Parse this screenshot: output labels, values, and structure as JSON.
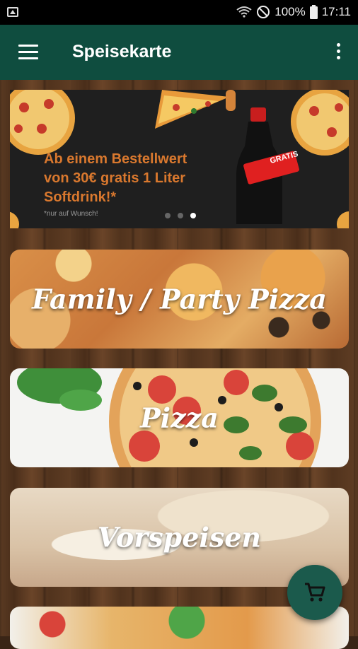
{
  "status_bar": {
    "battery": "100%",
    "time": "17:11"
  },
  "app_bar": {
    "title": "Speisekarte"
  },
  "banner": {
    "headline_lines": [
      "Ab einem Bestellwert",
      "von 30€ gratis 1 Liter",
      "Softdrink!*"
    ],
    "footnote": "*nur auf Wunsch!",
    "bottle_label": "GRATIS",
    "carousel_dots": 3,
    "active_dot": 3
  },
  "categories": [
    {
      "label": "Family / Party Pizza"
    },
    {
      "label": "Pizza"
    },
    {
      "label": "Vorspeisen"
    }
  ],
  "fab": {
    "icon": "cart-icon"
  },
  "colors": {
    "app_bar": "#0f4d3f",
    "fab": "#1b5a4c",
    "banner_text": "#d9782e"
  }
}
